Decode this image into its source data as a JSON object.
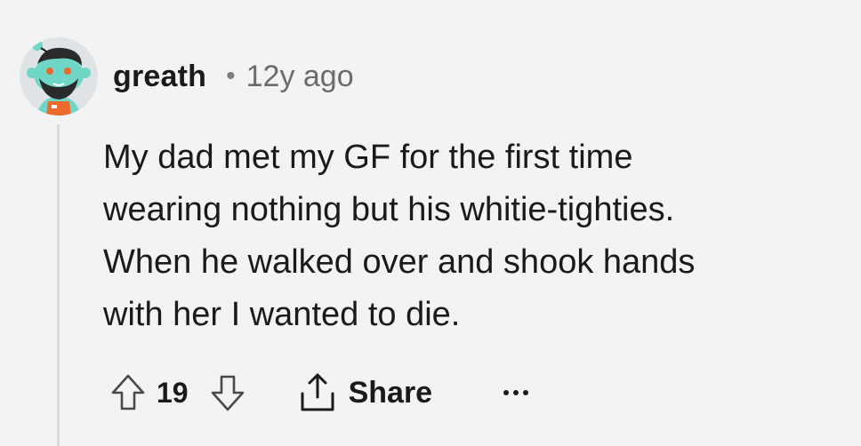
{
  "comment": {
    "author": "greath",
    "separator": "•",
    "timestamp": "12y ago",
    "body_lines": [
      "My dad met my GF for the first time",
      "wearing nothing but his whitie-tighties.",
      "When he walked over and shook hands",
      "with her I wanted to die."
    ],
    "score": "19",
    "share_label": "Share"
  },
  "icons": {
    "avatar": "snoo-avatar-icon",
    "upvote": "upvote-arrow-icon",
    "downvote": "downvote-arrow-icon",
    "share": "share-icon",
    "more": "more-options-icon"
  },
  "colors": {
    "background": "#f3f3f3",
    "text": "#1a1a1b",
    "muted": "#6c6c6c",
    "thread_line": "#dadada",
    "avatar_skin": "#6fd6c8",
    "avatar_overalls": "#ee6a2c"
  }
}
